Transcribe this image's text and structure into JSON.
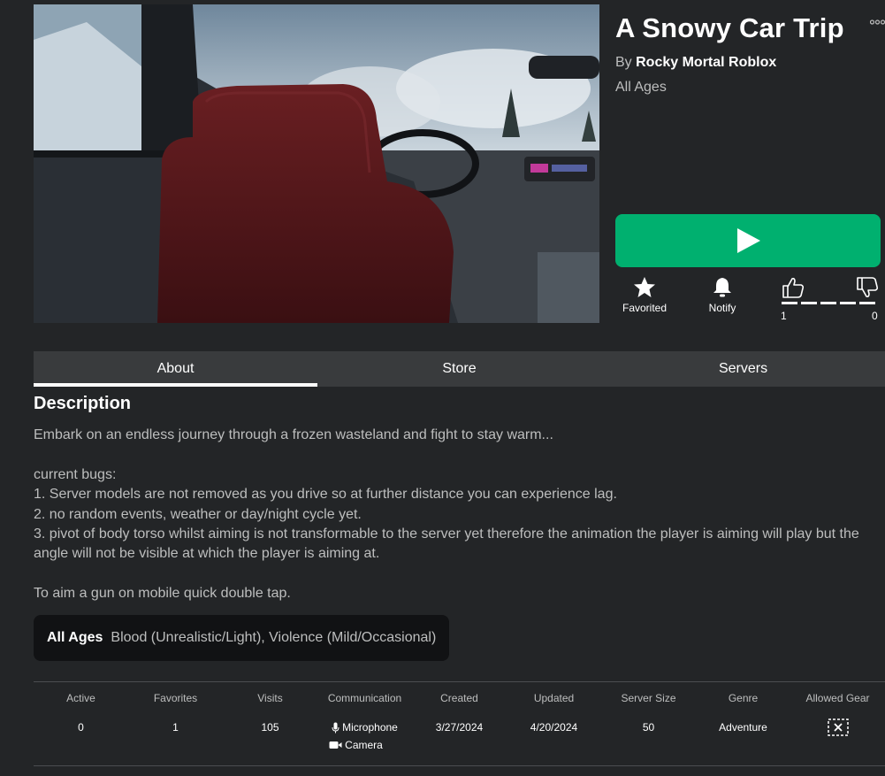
{
  "game": {
    "title": "A Snowy Car Trip",
    "by_prefix": "By",
    "creator": "Rocky Mortal Roblox",
    "age_rating": "All Ages"
  },
  "actions": {
    "favorite_label": "Favorited",
    "notify_label": "Notify",
    "upvotes": "1",
    "downvotes": "0"
  },
  "tabs": [
    {
      "label": "About"
    },
    {
      "label": "Store"
    },
    {
      "label": "Servers"
    }
  ],
  "description": {
    "heading": "Description",
    "text": "Embark on an endless journey through a frozen wasteland and fight to stay warm...\n\ncurrent bugs:\n1. Server models are not removed as you drive so at further distance you can experience lag.\n2. no random events, weather or day/night cycle yet.\n3. pivot of body torso whilst aiming is not transformable to the server yet therefore the animation the player is aiming will play but the angle will not be visible at which the player is aiming at.\n\nTo aim a gun on mobile quick double tap."
  },
  "rating_box": {
    "label": "All Ages",
    "descriptors": "Blood (Unrealistic/Light), Violence (Mild/Occasional)"
  },
  "stats": {
    "active": {
      "label": "Active",
      "value": "0"
    },
    "favorites": {
      "label": "Favorites",
      "value": "1"
    },
    "visits": {
      "label": "Visits",
      "value": "105"
    },
    "communication": {
      "label": "Communication",
      "microphone": "Microphone",
      "camera": "Camera"
    },
    "created": {
      "label": "Created",
      "value": "3/27/2024"
    },
    "updated": {
      "label": "Updated",
      "value": "4/20/2024"
    },
    "server_size": {
      "label": "Server Size",
      "value": "50"
    },
    "genre": {
      "label": "Genre",
      "value": "Adventure"
    },
    "allowed_gear": {
      "label": "Allowed Gear"
    }
  },
  "colors": {
    "background": "#232527",
    "play_button": "#00b06f",
    "tab_bar": "#393b3d",
    "rating_box": "#111214",
    "text_primary": "#ffffff",
    "text_secondary": "#bdbebe"
  },
  "icons": {
    "play": "play-icon",
    "favorite": "star-icon",
    "notify": "bell-icon",
    "upvote": "thumbs-up-icon",
    "downvote": "thumbs-down-icon",
    "more": "more-dots-icon",
    "microphone": "microphone-icon",
    "camera": "camera-icon",
    "no_gear": "no-gear-icon"
  }
}
